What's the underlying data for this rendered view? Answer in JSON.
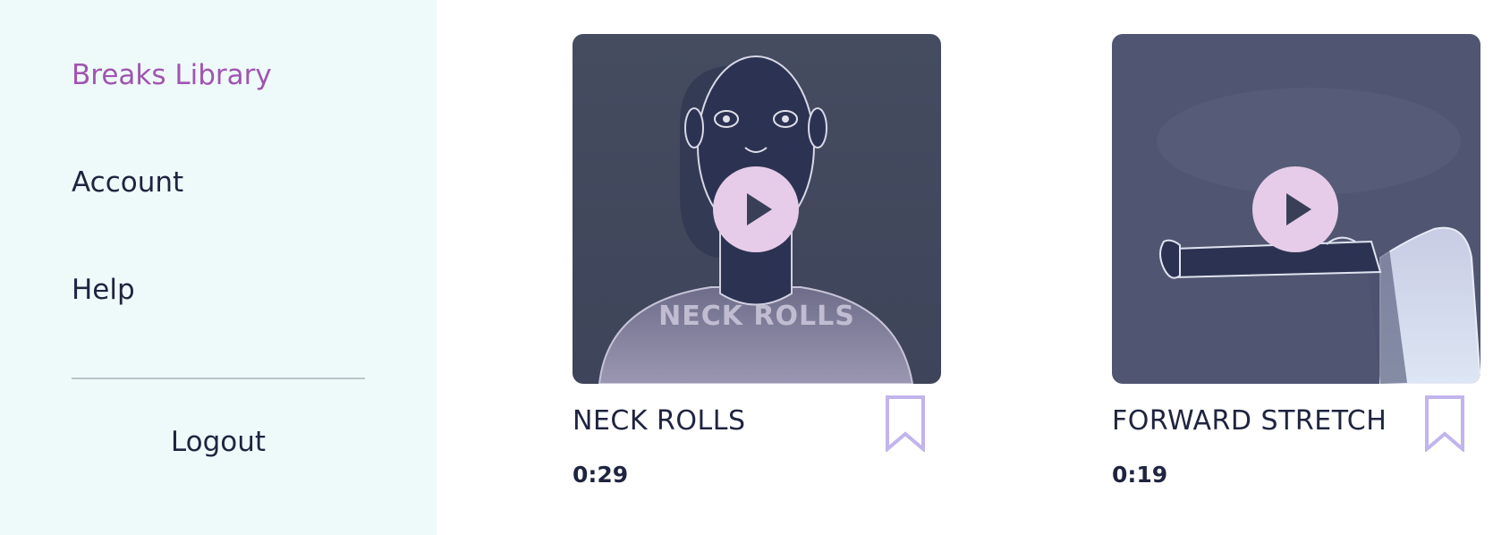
{
  "sidebar": {
    "items": [
      {
        "label": "Breaks Library",
        "active": true
      },
      {
        "label": "Account",
        "active": false
      },
      {
        "label": "Help",
        "active": false
      }
    ],
    "logout_label": "Logout"
  },
  "cards": [
    {
      "title": "NECK ROLLS",
      "thumbnail_text": "NECK ROLLS",
      "duration": "0:29",
      "icon": "play-icon",
      "bookmark_icon": "bookmark-icon"
    },
    {
      "title": "FORWARD STRETCH",
      "thumbnail_text": "",
      "duration": "0:19",
      "icon": "play-icon",
      "bookmark_icon": "bookmark-icon"
    }
  ],
  "colors": {
    "sidebar_bg": "#eefafa",
    "active_nav": "#a055b0",
    "text": "#1f2440",
    "play_button": "#e6cce8",
    "bookmark": "#c2b4ee",
    "thumb_bg": "#4a5068"
  }
}
